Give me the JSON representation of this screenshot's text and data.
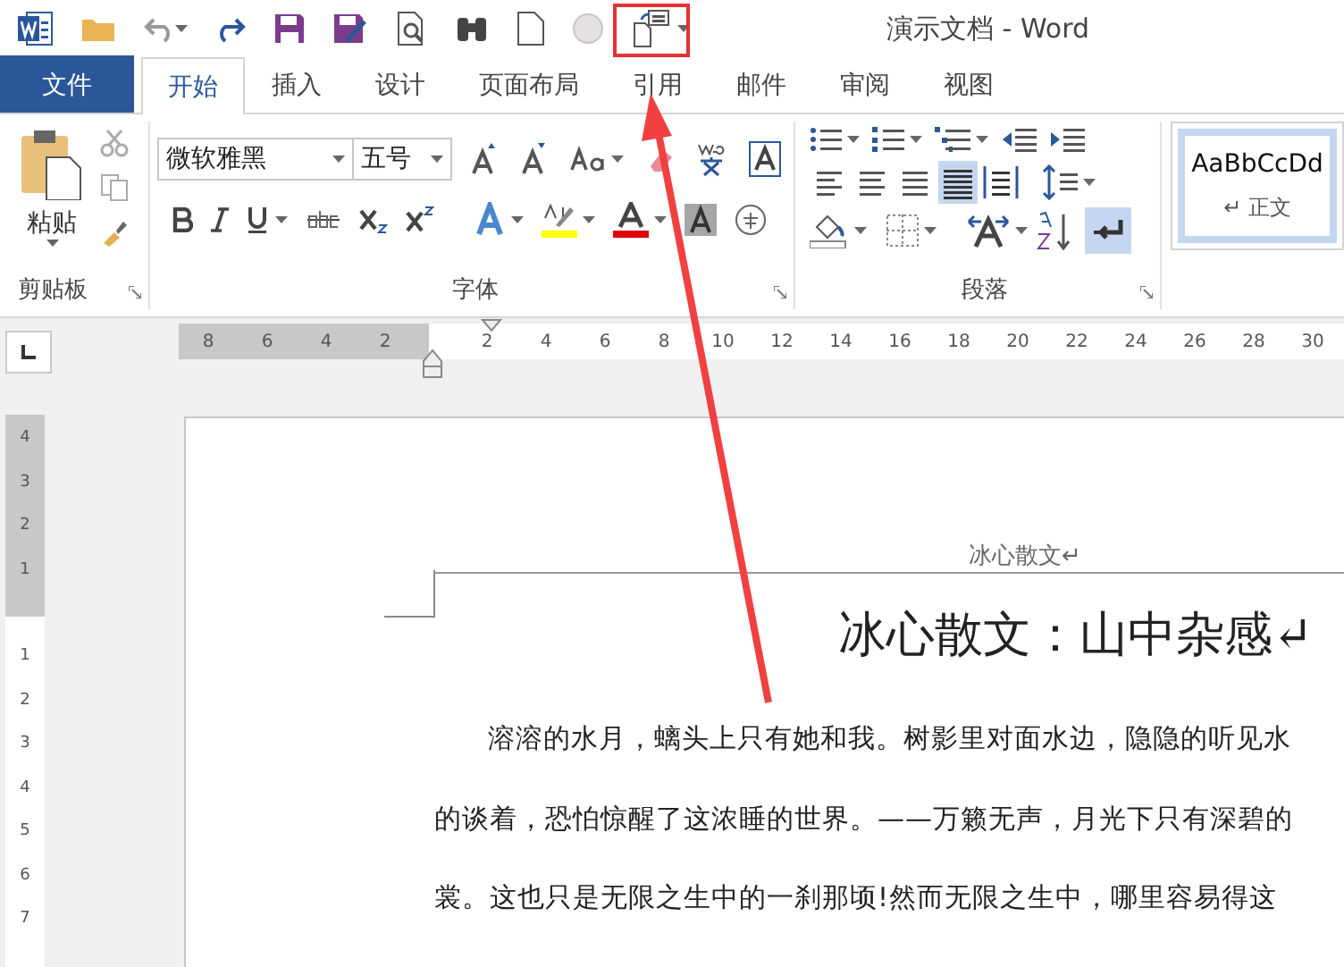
{
  "window": {
    "title": "演示文档 - Word"
  },
  "tabs": [
    {
      "label": "文件",
      "kind": "file",
      "selected": false
    },
    {
      "label": "开始",
      "kind": "tab",
      "selected": true
    },
    {
      "label": "插入",
      "kind": "tab",
      "selected": false
    },
    {
      "label": "设计",
      "kind": "tab",
      "selected": false
    },
    {
      "label": "页面布局",
      "kind": "tab",
      "selected": false
    },
    {
      "label": "引用",
      "kind": "tab",
      "selected": false
    },
    {
      "label": "邮件",
      "kind": "tab",
      "selected": false
    },
    {
      "label": "审阅",
      "kind": "tab",
      "selected": false
    },
    {
      "label": "视图",
      "kind": "tab",
      "selected": false
    }
  ],
  "clipboard": {
    "paste_label": "粘贴",
    "group_label": "剪贴板"
  },
  "font": {
    "font_name": "微软雅黑",
    "font_size": "五号",
    "group_label": "字体"
  },
  "paragraph": {
    "alignments": [
      {
        "kind": "left",
        "selected": false
      },
      {
        "kind": "center",
        "selected": false
      },
      {
        "kind": "right",
        "selected": false
      },
      {
        "kind": "justify",
        "selected": true
      },
      {
        "kind": "distribute",
        "selected": false
      }
    ],
    "show_marks_on": true,
    "group_label": "段落"
  },
  "styles": [
    {
      "preview": "AaBbCcDd",
      "name": "↵ 正文",
      "selected": true
    }
  ],
  "horizontal_ruler": {
    "left_marks": [
      "8",
      "6",
      "4",
      "2"
    ],
    "right_marks": [
      "2",
      "4",
      "6",
      "8",
      "10",
      "12",
      "14",
      "16",
      "18",
      "20",
      "22",
      "24",
      "26",
      "28",
      "30"
    ]
  },
  "vertical_ruler": {
    "top_marks": [
      "4",
      "3",
      "2",
      "1"
    ],
    "bottom_marks": [
      "1",
      "2",
      "3",
      "4",
      "5",
      "6",
      "7"
    ]
  },
  "document": {
    "header": "冰心散文↵",
    "title": "冰心散文：山中杂感↵",
    "lines": [
      "溶溶的水月，螭头上只有她和我。树影里对面水边，隐隐的听见水",
      "的谈着，恐怕惊醒了这浓睡的世界。——万籁无声，月光下只有深碧的",
      "裳。这也只是无限之生中的一刹那顷!然而无限之生中，哪里容易得这"
    ]
  }
}
